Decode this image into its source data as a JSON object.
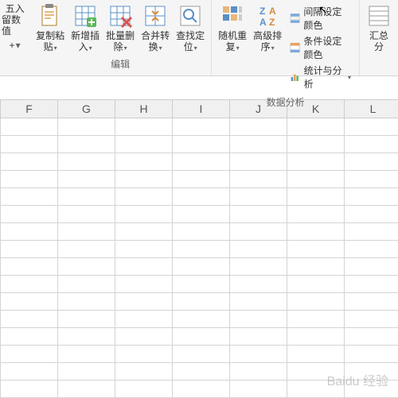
{
  "left": {
    "line1": "五入",
    "line2": "留数值"
  },
  "edit_group": {
    "name": "编辑",
    "copy_paste": "复制粘\n贴",
    "insert": "新增插\n入",
    "batch_delete": "批量删\n除",
    "merge_convert": "合并转\n换",
    "find_locate": "查找定\n位"
  },
  "data_group": {
    "name": "数据分析",
    "random_repeat": "随机重\n复",
    "adv_sort": "高级排\n序",
    "interval_color": "间隔设定颜色",
    "cond_color": "条件设定颜色",
    "stats": "统计与分析"
  },
  "right": {
    "huizong": "汇总",
    "fen": "分"
  },
  "columns": [
    "F",
    "G",
    "H",
    "I",
    "J",
    "K",
    "L",
    ""
  ],
  "watermark": "Baidu 经验"
}
